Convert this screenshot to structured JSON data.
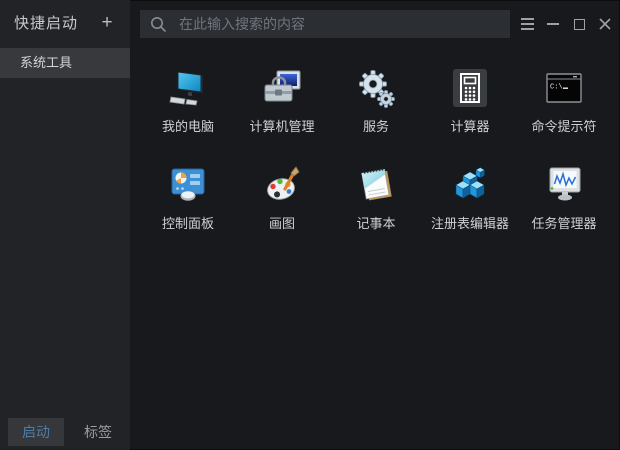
{
  "window": {
    "controls": [
      {
        "name": "menu",
        "icon": "hamburger-icon"
      },
      {
        "name": "minimize",
        "icon": "minimize-icon"
      },
      {
        "name": "maximize",
        "icon": "maximize-icon"
      },
      {
        "name": "close",
        "icon": "close-icon"
      }
    ]
  },
  "sidebar": {
    "title": "快捷启动",
    "add_button_label": "+",
    "items": [
      {
        "label": "系统工具",
        "selected": true
      }
    ],
    "tabs": [
      {
        "label": "启动",
        "active": true
      },
      {
        "label": "标签",
        "active": false
      }
    ]
  },
  "search": {
    "placeholder": "在此输入搜索的内容",
    "value": "",
    "icon": "search-icon"
  },
  "grid": {
    "items": [
      {
        "label": "我的电脑",
        "icon": "my-computer-icon"
      },
      {
        "label": "计算机管理",
        "icon": "computer-management-icon"
      },
      {
        "label": "服务",
        "icon": "services-gears-icon"
      },
      {
        "label": "计算器",
        "icon": "calculator-icon"
      },
      {
        "label": "命令提示符",
        "icon": "command-prompt-icon"
      },
      {
        "label": "控制面板",
        "icon": "control-panel-icon"
      },
      {
        "label": "画图",
        "icon": "paint-palette-icon"
      },
      {
        "label": "记事本",
        "icon": "notepad-icon"
      },
      {
        "label": "注册表编辑器",
        "icon": "registry-cubes-icon"
      },
      {
        "label": "任务管理器",
        "icon": "task-manager-icon"
      }
    ]
  },
  "colors": {
    "main_bg": "#17191c",
    "sidebar_bg": "#212326",
    "selected_item_bg": "#37393c",
    "search_bg": "#2b2e33",
    "accent_blue": "#4e7da9",
    "label_text": "#ced1d4",
    "placeholder_text": "#70767d"
  }
}
